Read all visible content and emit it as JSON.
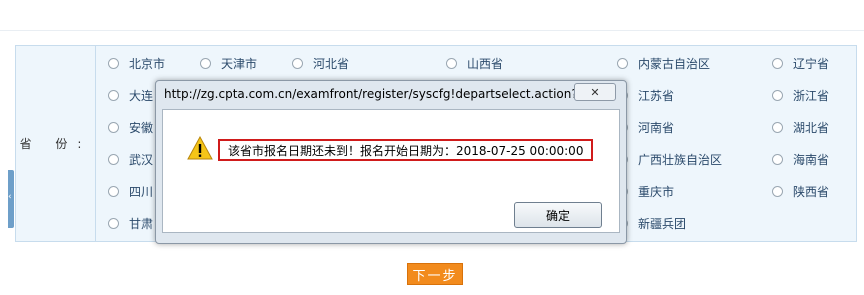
{
  "form": {
    "province_label": "省  份:",
    "options": [
      {
        "label": "北京市"
      },
      {
        "label": "天津市"
      },
      {
        "label": "河北省"
      },
      {
        "label": "山西省"
      },
      {
        "label": "内蒙古自治区"
      },
      {
        "label": "辽宁省"
      },
      {
        "label": "大连"
      },
      {
        "label": ""
      },
      {
        "label": ""
      },
      {
        "label": ""
      },
      {
        "label": "江苏省"
      },
      {
        "label": "浙江省"
      },
      {
        "label": "安徽"
      },
      {
        "label": ""
      },
      {
        "label": ""
      },
      {
        "label": ""
      },
      {
        "label": "河南省"
      },
      {
        "label": "湖北省"
      },
      {
        "label": "武汉"
      },
      {
        "label": ""
      },
      {
        "label": ""
      },
      {
        "label": ""
      },
      {
        "label": "广西壮族自治区"
      },
      {
        "label": "海南省"
      },
      {
        "label": "四川"
      },
      {
        "label": ""
      },
      {
        "label": ""
      },
      {
        "label": ""
      },
      {
        "label": "重庆市"
      },
      {
        "label": "陕西省"
      },
      {
        "label": "甘肃"
      },
      {
        "label": ""
      },
      {
        "label": ""
      },
      {
        "label": ""
      },
      {
        "label": "新疆兵团"
      },
      {
        "label": ""
      }
    ],
    "next_button": "下一步"
  },
  "dialog": {
    "title": "http://zg.cpta.com.cn/examfront/register/syscfg!departselect.action?...",
    "close_label": "✕",
    "message": "该省市报名日期还未到！报名开始日期为：2018-07-25 00:00:00",
    "ok_label": "确定"
  },
  "colors": {
    "table_bg": "#eef6fc",
    "accent_orange": "#f28b1d",
    "highlight_border": "#d01b1b"
  },
  "icons": {
    "warning": "warning-triangle-icon",
    "radio": "radio-icon",
    "close": "close-icon"
  }
}
